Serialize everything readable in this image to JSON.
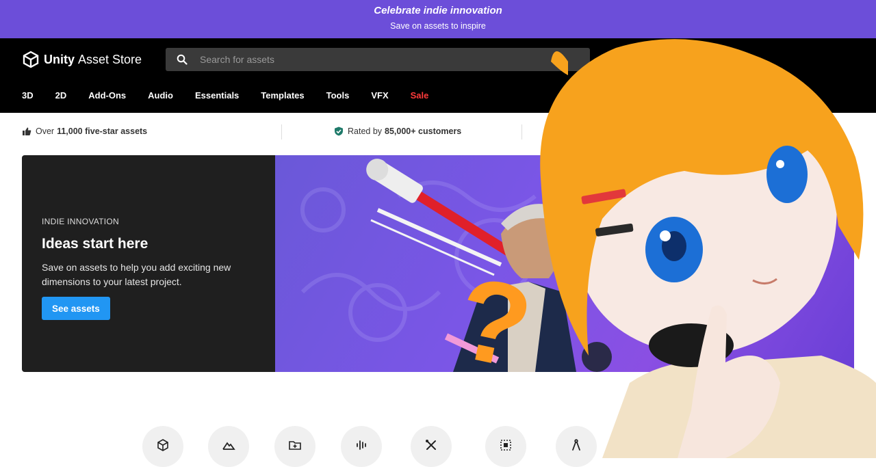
{
  "promo_banner": {
    "title": "Celebrate indie innovation",
    "subtitle": "Save on assets to inspire",
    "color": "#6c4ed9"
  },
  "header": {
    "logo_bold": "Unity",
    "logo_regular": "Asset Store",
    "search_placeholder": "Search for assets",
    "nav": [
      "3D",
      "2D",
      "Add-Ons",
      "Audio",
      "Essentials",
      "Templates",
      "Tools",
      "VFX",
      "Sale"
    ],
    "sale_color": "#ff3b3b"
  },
  "trust": {
    "stars_prefix": "Over",
    "stars_bold": "11,000 five-star assets",
    "rated_prefix": "Rated by",
    "rated_bold": "85,000+ customers"
  },
  "hero": {
    "tag": "INDIE INNOVATION",
    "title": "Ideas start here",
    "description": "Save on assets to help you add exciting new dimensions to your latest project.",
    "button": "See assets",
    "button_color": "#2196f3"
  },
  "categories": [
    {
      "icon": "3d-cube-icon"
    },
    {
      "icon": "mountains-2d-icon"
    },
    {
      "icon": "folder-plus-icon"
    },
    {
      "icon": "audio-wave-icon"
    },
    {
      "icon": "tools-icon"
    },
    {
      "icon": "vfx-frame-icon"
    },
    {
      "icon": "compass-icon"
    }
  ],
  "overlay": {
    "question_mark": "?",
    "accent": "#ff9a1f"
  }
}
